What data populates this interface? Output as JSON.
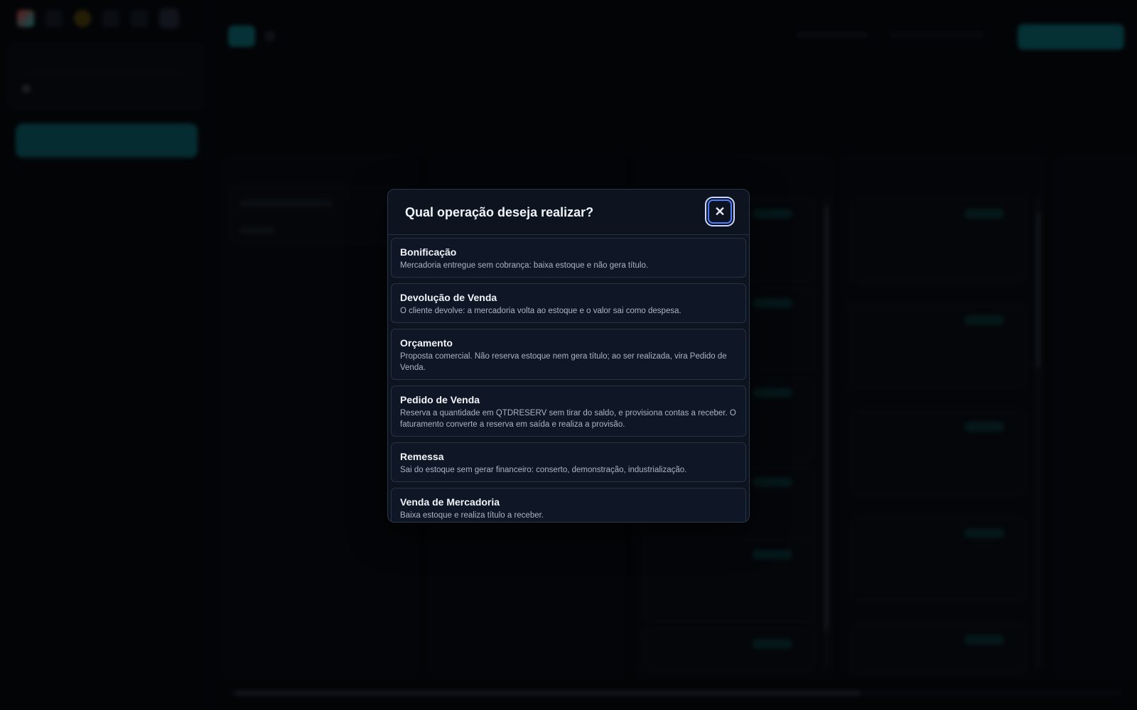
{
  "modal": {
    "title": "Qual operação deseja realizar?",
    "close_icon": "close-icon",
    "operations": [
      {
        "title": "Bonificação",
        "description": "Mercadoria entregue sem cobrança: baixa estoque e não gera título."
      },
      {
        "title": "Devolução de Venda",
        "description": "O cliente devolve: a mercadoria volta ao estoque e o valor sai como despesa."
      },
      {
        "title": "Orçamento",
        "description": "Proposta comercial. Não reserva estoque nem gera título; ao ser realizada, vira Pedido de Venda."
      },
      {
        "title": "Pedido de Venda",
        "description": "Reserva a quantidade em QTDRESERV sem tirar do saldo, e provisiona contas a receber. O faturamento converte a reserva em saída e realiza a provisão."
      },
      {
        "title": "Remessa",
        "description": "Sai do estoque sem gerar financeiro: conserto, demonstração, industrialização."
      },
      {
        "title": "Venda de Mercadoria",
        "description": "Baixa estoque e realiza título a receber."
      }
    ]
  },
  "colors": {
    "accent": "#0e7780",
    "modal_bg": "#0d1420",
    "focus_ring": "#4a7cff"
  }
}
